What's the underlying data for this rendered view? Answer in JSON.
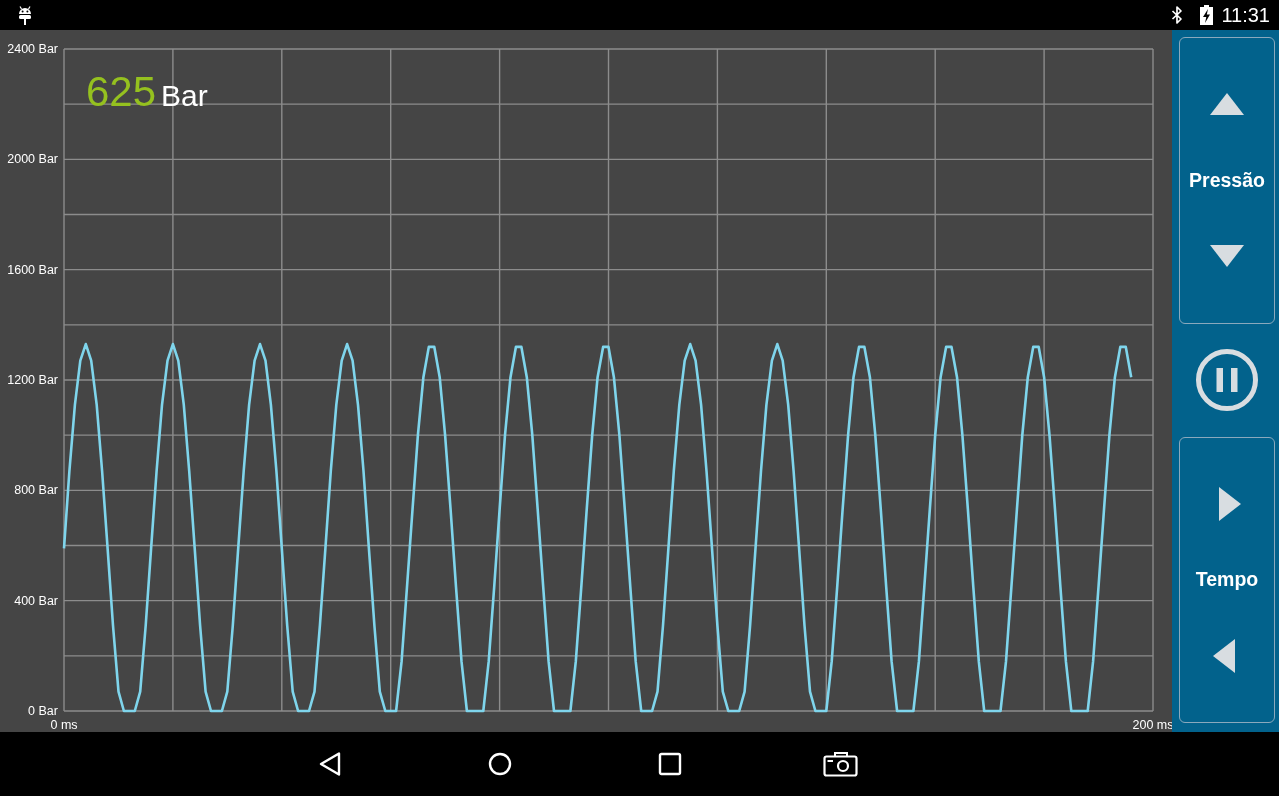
{
  "status_bar": {
    "time": "11:31"
  },
  "readout": {
    "value": "625",
    "unit": "Bar"
  },
  "chart": {
    "chart_data": {
      "type": "line",
      "xlim": [
        0,
        200
      ],
      "ylim": [
        0,
        2400
      ],
      "xticks": [
        {
          "value": 0,
          "label": "0 ms"
        },
        {
          "value": 200,
          "label": "200 ms"
        }
      ],
      "yticks": [
        {
          "value": 0,
          "label": "0 Bar"
        },
        {
          "value": 400,
          "label": "400 Bar"
        },
        {
          "value": 800,
          "label": "800 Bar"
        },
        {
          "value": 1200,
          "label": "1200 Bar"
        },
        {
          "value": 1600,
          "label": "1600 Bar"
        },
        {
          "value": 2000,
          "label": "2000 Bar"
        },
        {
          "value": 2400,
          "label": "2400 Bar"
        }
      ],
      "grid": true,
      "color": "#7fd5ec",
      "x": [
        0,
        1,
        2,
        3,
        4,
        5,
        6,
        7,
        8,
        9,
        10,
        11,
        12,
        13,
        14,
        15,
        16,
        17,
        18,
        19,
        20,
        21,
        22,
        23,
        24,
        25,
        26,
        27,
        28,
        29,
        30,
        31,
        32,
        33,
        34,
        35,
        36,
        37,
        38,
        39,
        40,
        41,
        42,
        43,
        44,
        45,
        46,
        47,
        48,
        49,
        50,
        51,
        52,
        53,
        54,
        55,
        56,
        57,
        58,
        59,
        60,
        61,
        62,
        63,
        64,
        65,
        66,
        67,
        68,
        69,
        70,
        71,
        72,
        73,
        74,
        75,
        76,
        77,
        78,
        79,
        80,
        81,
        82,
        83,
        84,
        85,
        86,
        87,
        88,
        89,
        90,
        91,
        92,
        93,
        94,
        95,
        96,
        97,
        98,
        99,
        100,
        101,
        102,
        103,
        104,
        105,
        106,
        107,
        108,
        109,
        110,
        111,
        112,
        113,
        114,
        115,
        116,
        117,
        118,
        119,
        120,
        121,
        122,
        123,
        124,
        125,
        126,
        127,
        128,
        129,
        130,
        131,
        132,
        133,
        134,
        135,
        136,
        137,
        138,
        139,
        140,
        141,
        142,
        143,
        144,
        145,
        146,
        147,
        148,
        149,
        150,
        151,
        152,
        153,
        154,
        155,
        156,
        157,
        158,
        159,
        160,
        161,
        162,
        163,
        164,
        165,
        166,
        167,
        168,
        169,
        170,
        171,
        172,
        173,
        174,
        175,
        176,
        177,
        178,
        179,
        180,
        181,
        182,
        183,
        184,
        185,
        186,
        187,
        188,
        189,
        190,
        191,
        192,
        193,
        194,
        195,
        196
      ],
      "values": [
        590,
        870,
        1110,
        1270,
        1330,
        1270,
        1110,
        870,
        590,
        310,
        70,
        0,
        0,
        0,
        70,
        310,
        590,
        870,
        1110,
        1270,
        1330,
        1270,
        1110,
        870,
        590,
        310,
        70,
        0,
        0,
        0,
        70,
        310,
        590,
        870,
        1110,
        1270,
        1330,
        1270,
        1110,
        870,
        590,
        310,
        70,
        0,
        0,
        0,
        70,
        310,
        590,
        870,
        1110,
        1270,
        1330,
        1270,
        1110,
        870,
        590,
        310,
        70,
        0,
        0,
        0,
        180,
        450,
        730,
        1000,
        1210,
        1320,
        1320,
        1210,
        1000,
        730,
        450,
        180,
        0,
        0,
        0,
        0,
        180,
        450,
        730,
        1000,
        1210,
        1320,
        1320,
        1210,
        1000,
        730,
        450,
        180,
        0,
        0,
        0,
        0,
        180,
        450,
        730,
        1000,
        1210,
        1320,
        1320,
        1210,
        1000,
        730,
        450,
        180,
        0,
        0,
        0,
        70,
        310,
        590,
        870,
        1110,
        1270,
        1330,
        1270,
        1110,
        870,
        590,
        310,
        70,
        0,
        0,
        0,
        70,
        310,
        590,
        870,
        1110,
        1270,
        1330,
        1270,
        1110,
        870,
        590,
        310,
        70,
        0,
        0,
        0,
        180,
        450,
        730,
        1000,
        1210,
        1320,
        1320,
        1210,
        1000,
        730,
        450,
        180,
        0,
        0,
        0,
        0,
        180,
        450,
        730,
        1000,
        1210,
        1320,
        1320,
        1210,
        1000,
        730,
        450,
        180,
        0,
        0,
        0,
        0,
        180,
        450,
        730,
        1000,
        1210,
        1320,
        1320,
        1210,
        1000,
        730,
        450,
        180,
        0,
        0,
        0,
        0,
        180,
        450,
        730,
        1000,
        1210,
        1320,
        1320,
        1210
      ]
    }
  },
  "controls": [
    {
      "kind": "vertical_stepper",
      "label": "Pressão"
    },
    {
      "kind": "pause_toggle",
      "running": true
    },
    {
      "kind": "horizontal_stepper",
      "label": "Tempo"
    }
  ]
}
